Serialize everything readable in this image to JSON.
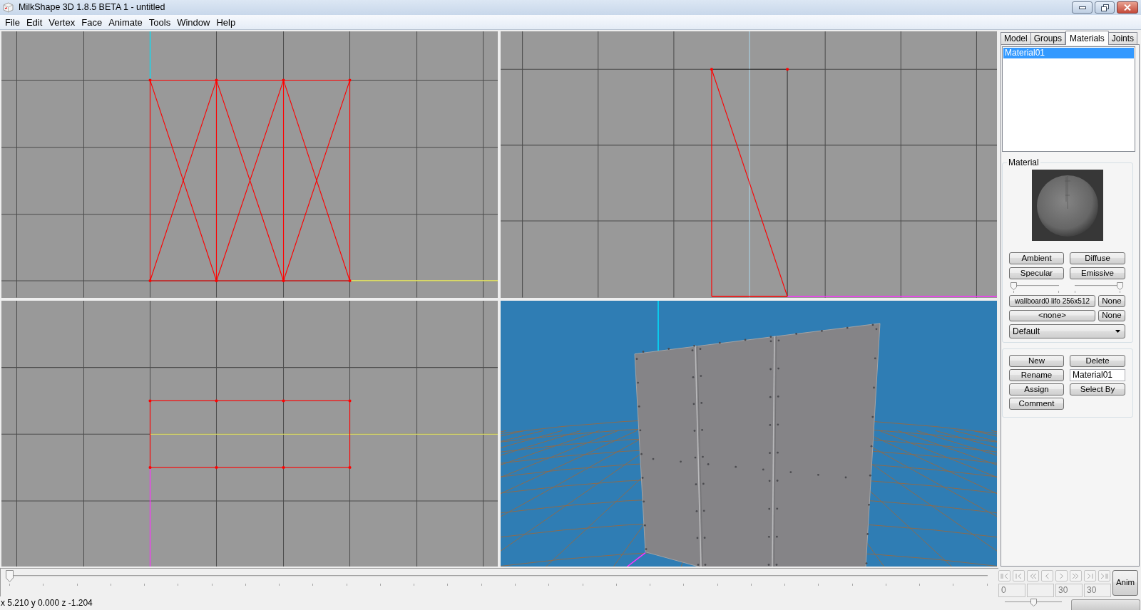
{
  "window": {
    "title": "MilkShape 3D 1.8.5 BETA 1 - untitled"
  },
  "menu": [
    "File",
    "Edit",
    "Vertex",
    "Face",
    "Animate",
    "Tools",
    "Window",
    "Help"
  ],
  "viewports": [
    {
      "kind": "front"
    },
    {
      "kind": "side"
    },
    {
      "kind": "top"
    },
    {
      "kind": "perspective"
    }
  ],
  "side_panel": {
    "tabs": [
      {
        "label": "Model",
        "selected": false
      },
      {
        "label": "Groups",
        "selected": false
      },
      {
        "label": "Materials",
        "selected": true
      },
      {
        "label": "Joints",
        "selected": false
      }
    ],
    "materials": [
      {
        "name": "Material01",
        "selected": true
      }
    ],
    "material": {
      "title": "Material",
      "color_buttons": [
        "Ambient",
        "Diffuse",
        "Specular",
        "Emissive"
      ],
      "sliders": [
        {
          "level": 0
        },
        {
          "level": 1
        }
      ],
      "texture": {
        "label": "wallboard0 lifo 256x512",
        "clear": "None"
      },
      "alpha_map": {
        "label": "<none>",
        "clear": "None"
      },
      "mode": "Default"
    },
    "actions": {
      "new": "New",
      "delete": "Delete",
      "rename": "Rename",
      "name_value": "Material01",
      "assign": "Assign",
      "select_by": "Select By",
      "comment": "Comment"
    }
  },
  "timeline": {
    "level": 0
  },
  "animation": {
    "disabled": true,
    "frame_fields": [
      {
        "value": "0"
      },
      {
        "value": "30"
      },
      {
        "value": "30"
      }
    ],
    "anim_button": "Anim",
    "speed": {
      "level": 0.5
    }
  },
  "status_bar": {
    "coordinates": "x 5.210 y 0.000 z -1.204"
  }
}
